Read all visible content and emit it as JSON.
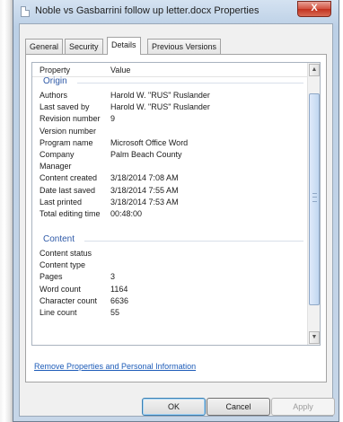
{
  "window": {
    "title": "Noble vs Gasbarrini follow up letter.docx Properties",
    "close_glyph": "X"
  },
  "tabs": [
    {
      "label": "General"
    },
    {
      "label": "Security"
    },
    {
      "label": "Details"
    },
    {
      "label": "Previous Versions"
    }
  ],
  "active_tab": "Details",
  "list": {
    "header": {
      "property": "Property",
      "value": "Value"
    },
    "groups": {
      "origin": "Origin",
      "content": "Content"
    },
    "origin_rows": [
      {
        "key": "Authors",
        "value": "Harold W. \"RUS\" Ruslander"
      },
      {
        "key": "Last saved by",
        "value": "Harold W. \"RUS\" Ruslander"
      },
      {
        "key": "Revision number",
        "value": "9"
      },
      {
        "key": "Version number",
        "value": ""
      },
      {
        "key": "Program name",
        "value": "Microsoft Office Word"
      },
      {
        "key": "Company",
        "value": "Palm Beach County"
      },
      {
        "key": "Manager",
        "value": ""
      },
      {
        "key": "Content created",
        "value": "3/18/2014 7:08 AM"
      },
      {
        "key": "Date last saved",
        "value": "3/18/2014 7:55 AM"
      },
      {
        "key": "Last printed",
        "value": "3/18/2014 7:53 AM"
      },
      {
        "key": "Total editing time",
        "value": "00:48:00"
      }
    ],
    "content_rows": [
      {
        "key": "Content status",
        "value": ""
      },
      {
        "key": "Content type",
        "value": ""
      },
      {
        "key": "Pages",
        "value": "3"
      },
      {
        "key": "Word count",
        "value": "1164"
      },
      {
        "key": "Character count",
        "value": "6636"
      },
      {
        "key": "Line count",
        "value": "55"
      }
    ]
  },
  "remove_link": "Remove Properties and Personal Information",
  "buttons": {
    "ok": "OK",
    "cancel": "Cancel",
    "apply": "Apply"
  },
  "colors": {
    "group_heading": "#2f5aa8",
    "link": "#1c5bb8",
    "close_button": "#c1321f"
  }
}
